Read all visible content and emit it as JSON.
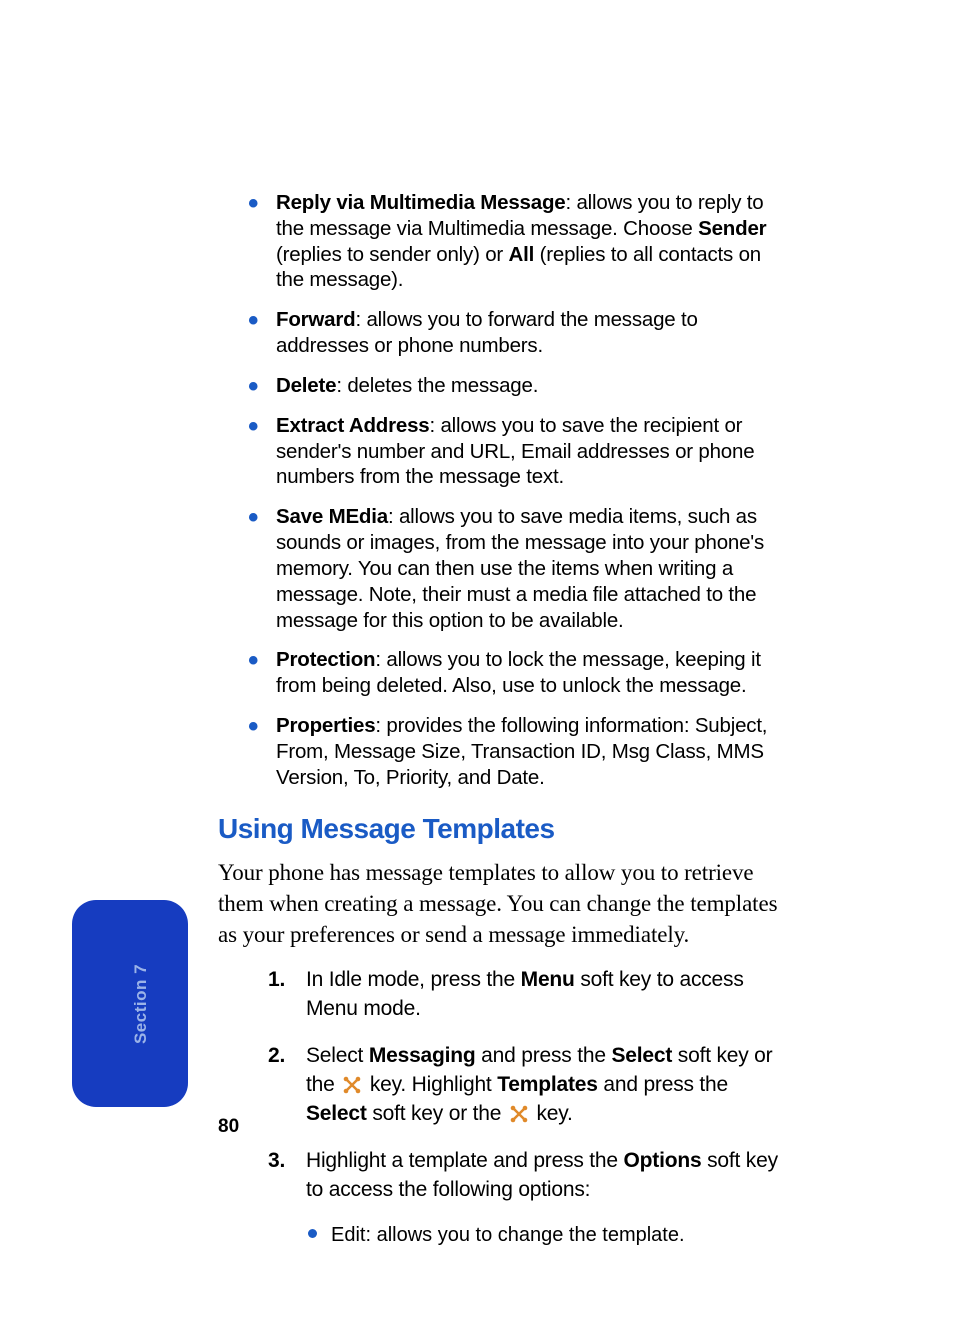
{
  "options_list": [
    {
      "term": "Reply via Multimedia Message",
      "text_before": ": allows you to reply to the message via Multimedia message. Choose ",
      "bold1": "Sender",
      "text_mid": " (replies to sender only) or ",
      "bold2": "All",
      "text_after": " (replies to all contacts on the message)."
    },
    {
      "term": "Forward",
      "text": ": allows you to forward the message to addresses or phone numbers."
    },
    {
      "term": "Delete",
      "text": ": deletes the message."
    },
    {
      "term": "Extract Address",
      "text": ": allows you to save the recipient or sender's number and URL, Email addresses or phone numbers from the message text."
    },
    {
      "term": "Save MEdia",
      "text": ": allows you to save media items, such as sounds or images, from the message into your phone's memory. You can then use the items when writing a message. Note, their must a media file attached to the message for this option to be available."
    },
    {
      "term": "Protection",
      "text": ": allows you to lock the message, keeping it from being deleted. Also, use to unlock the message."
    },
    {
      "term": "Properties",
      "text": ": provides the following information: Subject, From, Message Size, Transaction ID, Msg Class, MMS Version, To, Priority, and Date."
    }
  ],
  "heading": "Using Message Templates",
  "intro": "Your phone has message templates to allow you to retrieve them when creating a message. You can change the templates as your preferences or send a message immediately.",
  "steps": {
    "s1": {
      "marker": "1.",
      "pre": "In Idle mode, press the ",
      "b1": "Menu",
      "post": " soft key to access Menu mode."
    },
    "s2": {
      "marker": "2.",
      "p1": "Select ",
      "b1": "Messaging",
      "p2": " and press the ",
      "b2": "Select",
      "p3": " soft key or the ",
      "p4": " key. Highlight ",
      "b3": "Templates",
      "p5": " and press the ",
      "b4": "Select",
      "p6": " soft key or the ",
      "p7": " key."
    },
    "s3": {
      "marker": "3.",
      "p1": "Highlight a template and press the ",
      "b1": "Options",
      "p2": " soft key to access the following options:"
    }
  },
  "sub_bullet": "Edit: allows you to change the template.",
  "section_tab_label": "Section 7",
  "page_number": "80"
}
